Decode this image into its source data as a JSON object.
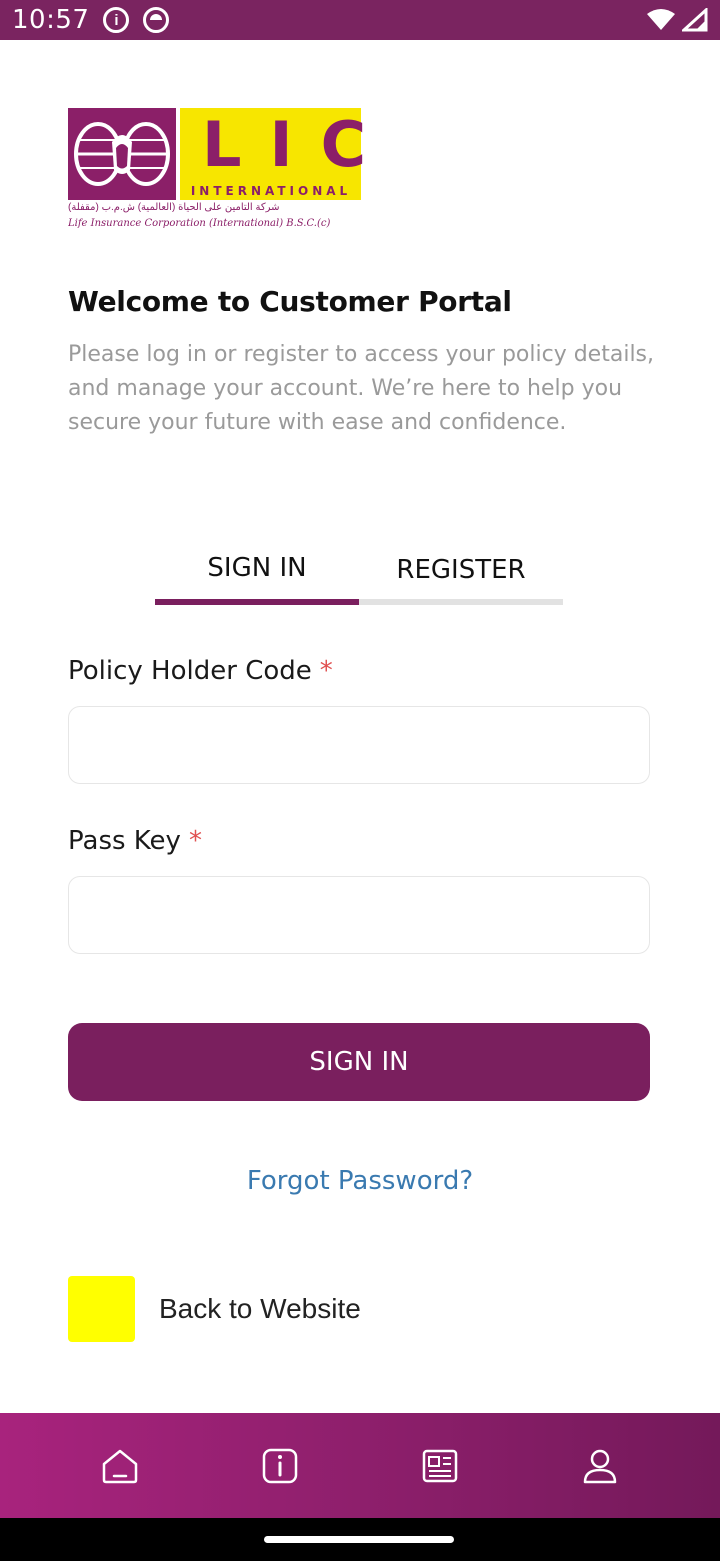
{
  "status_bar": {
    "time": "10:57",
    "icons": [
      "info-icon",
      "circle-status-icon",
      "wifi-icon",
      "signal-icon"
    ]
  },
  "logo": {
    "main_text": "LIC",
    "sub_text": "INTERNATIONAL",
    "arabic_text": "شركة التأمين على الحياة (العالمية) ش.م.ب (مقفلة)",
    "english_text": "Life Insurance Corporation (International) B.S.C.(c)",
    "colors": {
      "purple": "#8b1f68",
      "yellow": "#f7e600"
    }
  },
  "welcome": {
    "title": "Welcome to Customer Portal",
    "description": "Please log in or register to access your policy details, and manage your account. We’re here to help you secure your future with ease and confidence."
  },
  "tabs": {
    "sign_in": "SIGN IN",
    "register": "REGISTER",
    "active": "sign_in"
  },
  "form": {
    "policy_holder_code": {
      "label": "Policy Holder Code",
      "required_mark": "*",
      "value": ""
    },
    "pass_key": {
      "label": "Pass Key",
      "required_mark": "*",
      "value": ""
    },
    "submit_label": "SIGN IN"
  },
  "links": {
    "forgot_password": "Forgot Password?",
    "back_to_website": "Back to Website"
  },
  "bottom_nav": {
    "items": [
      "home-icon",
      "info-icon",
      "news-icon",
      "profile-icon"
    ]
  },
  "colors": {
    "primary": "#7a1f5e",
    "link": "#3a7ab0",
    "required": "#e05050",
    "back_icon": "#ffff00"
  }
}
